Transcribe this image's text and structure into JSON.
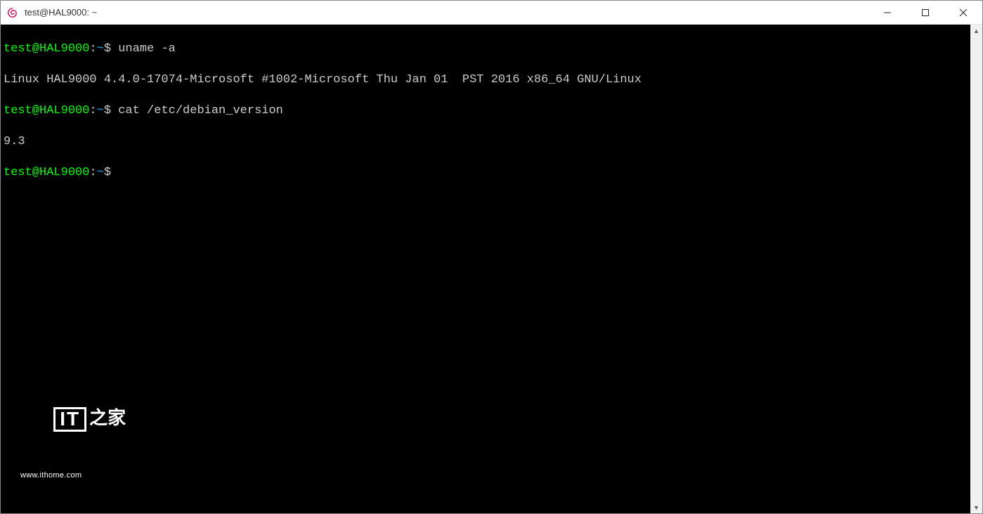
{
  "window": {
    "title": "test@HAL9000: ~",
    "icon_name": "debian-swirl-icon",
    "icon_color": "#d70a53"
  },
  "window_controls": {
    "minimize_name": "minimize-icon",
    "maximize_name": "maximize-icon",
    "close_name": "close-icon"
  },
  "terminal": {
    "prompt": {
      "user_host": "test@HAL9000",
      "separator": ":",
      "path": "~",
      "symbol": "$"
    },
    "lines": {
      "l1_cmd": " uname -a",
      "l2_out": "Linux HAL9000 4.4.0-17074-Microsoft #1002-Microsoft Thu Jan 01  PST 2016 x86_64 GNU/Linux",
      "l3_cmd": " cat /etc/debian_version",
      "l4_out": "9.3",
      "l5_cmd": ""
    },
    "colors": {
      "background": "#000000",
      "foreground": "#cccccc",
      "user_host": "#00ff00",
      "path": "#00bfff"
    }
  },
  "watermark": {
    "box_text": "IT",
    "side_text": "之家",
    "url": "www.ithome.com"
  }
}
